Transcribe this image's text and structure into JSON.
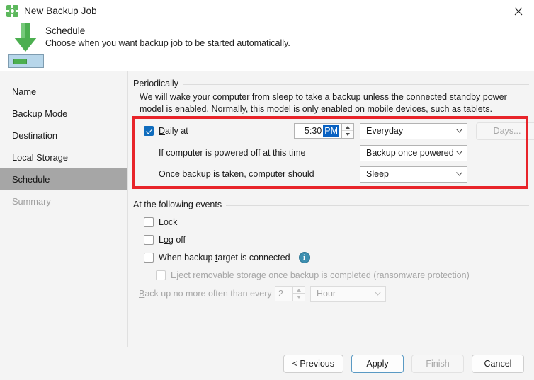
{
  "window": {
    "title": "New Backup Job",
    "icon": "gear-icon",
    "close_label": "✕"
  },
  "header": {
    "title": "Schedule",
    "subtitle": "Choose when you want backup job to be started automatically.",
    "icon": "download-to-drive-icon"
  },
  "sidebar": {
    "items": [
      {
        "label": "Name",
        "state": "normal"
      },
      {
        "label": "Backup Mode",
        "state": "normal"
      },
      {
        "label": "Destination",
        "state": "normal"
      },
      {
        "label": "Local Storage",
        "state": "normal"
      },
      {
        "label": "Schedule",
        "state": "selected"
      },
      {
        "label": "Summary",
        "state": "disabled"
      }
    ]
  },
  "periodically": {
    "group_label": "Periodically",
    "description": "We will wake your computer from sleep to take a backup unless the connected standby power model is enabled. Normally, this model is only enabled on mobile devices, such as tablets.",
    "daily": {
      "label_pre": "D",
      "label_post": "aily at",
      "checked": true,
      "time_value": "5:30",
      "time_ampm": "PM",
      "frequency": "Everyday",
      "days_button": "Days...",
      "days_button_enabled": false
    },
    "powered_off": {
      "label": "If computer is powered off at this time",
      "value": "Backup once powered c"
    },
    "after_backup": {
      "label": "Once backup is taken, computer should",
      "value": "Sleep"
    }
  },
  "events": {
    "group_label": "At the following events",
    "items": [
      {
        "pre": "Loc",
        "mn": "k",
        "post": "",
        "checked": false,
        "enabled": true,
        "info": false
      },
      {
        "pre": "L",
        "mn": "o",
        "post": "g off",
        "checked": false,
        "enabled": true,
        "info": false
      },
      {
        "pre": "When backup ",
        "mn": "t",
        "post": "arget is connected",
        "checked": false,
        "enabled": true,
        "info": true
      }
    ],
    "eject": {
      "label": "Eject removable storage once backup is completed (ransomware protection)",
      "checked": false,
      "enabled": false
    },
    "throttle": {
      "label_pre": "B",
      "label_mn": "",
      "label_post": "ack up no more often than every",
      "value": "2",
      "unit": "Hour",
      "enabled": false
    },
    "info_icon_label": "i"
  },
  "footer": {
    "buttons": [
      {
        "label": "< Previous",
        "state": "normal",
        "name": "previous-button"
      },
      {
        "label": "Apply",
        "state": "default",
        "name": "apply-button"
      },
      {
        "label": "Finish",
        "state": "disabled",
        "name": "finish-button"
      },
      {
        "label": "Cancel",
        "state": "normal",
        "name": "cancel-button"
      }
    ]
  },
  "colors": {
    "accent": "#0f6cbd",
    "highlight": "#e8242a",
    "brand_green": "#4caf50"
  }
}
